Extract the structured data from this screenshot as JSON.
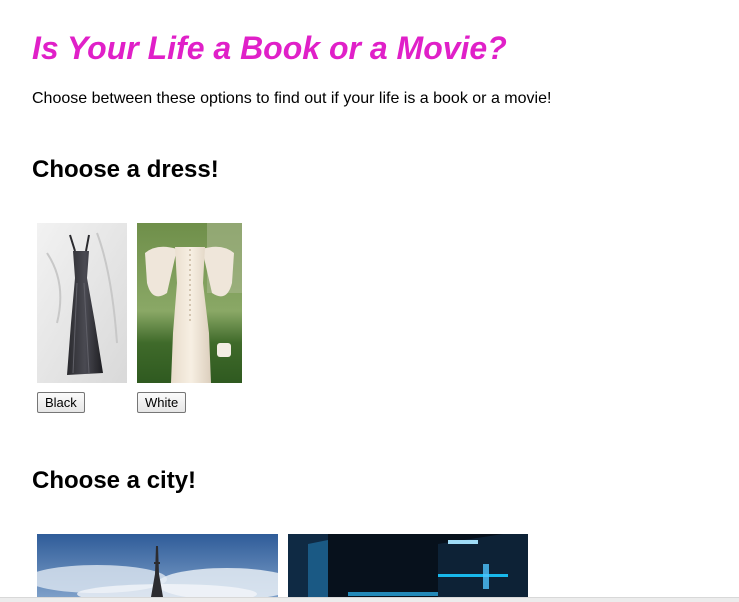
{
  "header": {
    "title": "Is Your Life a Book or a Movie?",
    "intro": "Choose between these options to find out if your life is a book or a movie!"
  },
  "dress_section": {
    "heading": "Choose a dress!",
    "options": [
      {
        "label": "Black"
      },
      {
        "label": "White"
      }
    ]
  },
  "city_section": {
    "heading": "Choose a city!"
  },
  "colors": {
    "title": "#e020c8"
  }
}
